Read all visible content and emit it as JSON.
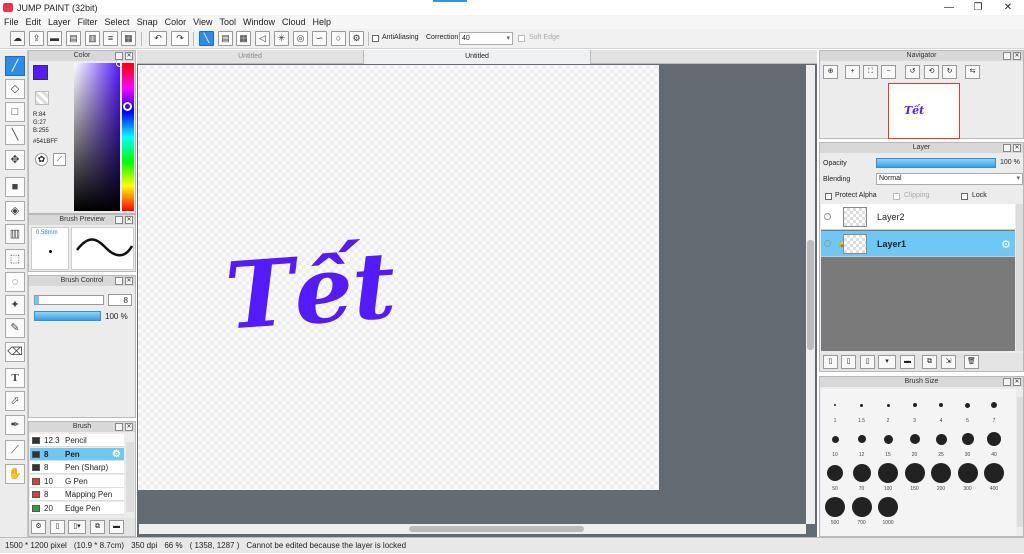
{
  "titlebar": {
    "title": "JUMP PAINT (32bit)",
    "minimize": "—",
    "maximize": "❐",
    "close": "✕"
  },
  "menu": [
    "File",
    "Edit",
    "Layer",
    "Filter",
    "Select",
    "Snap",
    "Color",
    "View",
    "Tool",
    "Window",
    "Cloud",
    "Help"
  ],
  "toolbar": {
    "antialiasing_label": "AntiAliasing",
    "correction_label": "Correction",
    "correction_value": "40",
    "soft_edge_label": "Soft Edge"
  },
  "color_panel": {
    "title": "Color",
    "r": "R:84",
    "g": "G:27",
    "b": "B:255",
    "hex": "#541BFF",
    "main_color": "#541bff"
  },
  "brush_preview": {
    "title": "Brush Preview",
    "size": "0.58mm"
  },
  "brush_control": {
    "title": "Brush Control",
    "size_value": "8",
    "opacity_value": "100 %"
  },
  "brush_panel": {
    "title": "Brush",
    "items": [
      {
        "num": "12.3",
        "name": "Pencil",
        "color": "#333333"
      },
      {
        "num": "8",
        "name": "Pen",
        "color": "#333333",
        "selected": true
      },
      {
        "num": "8",
        "name": "Pen (Sharp)",
        "color": "#333333"
      },
      {
        "num": "10",
        "name": "G Pen",
        "color": "#e53935"
      },
      {
        "num": "8",
        "name": "Mapping Pen",
        "color": "#e53935"
      },
      {
        "num": "20",
        "name": "Edge Pen",
        "color": "#2e9e3e"
      }
    ]
  },
  "canvas": {
    "tabs": [
      "Untitled",
      "Untitled"
    ],
    "artwork_text": "Tết"
  },
  "navigator": {
    "title": "Navigator",
    "thumb_text": "Tết"
  },
  "layer_panel": {
    "title": "Layer",
    "opacity_label": "Opacity",
    "opacity_value": "100 %",
    "blending_label": "Blending",
    "blending_value": "Normal",
    "protect_alpha": "Protect Alpha",
    "clipping": "Clipping",
    "lock": "Lock",
    "layers": [
      {
        "name": "Layer2",
        "selected": false
      },
      {
        "name": "Layer1",
        "selected": true
      }
    ]
  },
  "brush_size_panel": {
    "title": "Brush Size",
    "sizes": [
      "1",
      "1.5",
      "2",
      "3",
      "4",
      "5",
      "7",
      "10",
      "12",
      "15",
      "20",
      "25",
      "30",
      "40",
      "50",
      "70",
      "100",
      "150",
      "200",
      "300",
      "400",
      "500",
      "700",
      "1000"
    ]
  },
  "statusbar": {
    "dims": "1500 * 1200 pixel",
    "cm": "(10.9 * 8.7cm)",
    "dpi": "350 dpi",
    "zoom": "66 %",
    "coords": "( 1358, 1287 )",
    "message": "Cannot be edited because the layer is locked"
  }
}
